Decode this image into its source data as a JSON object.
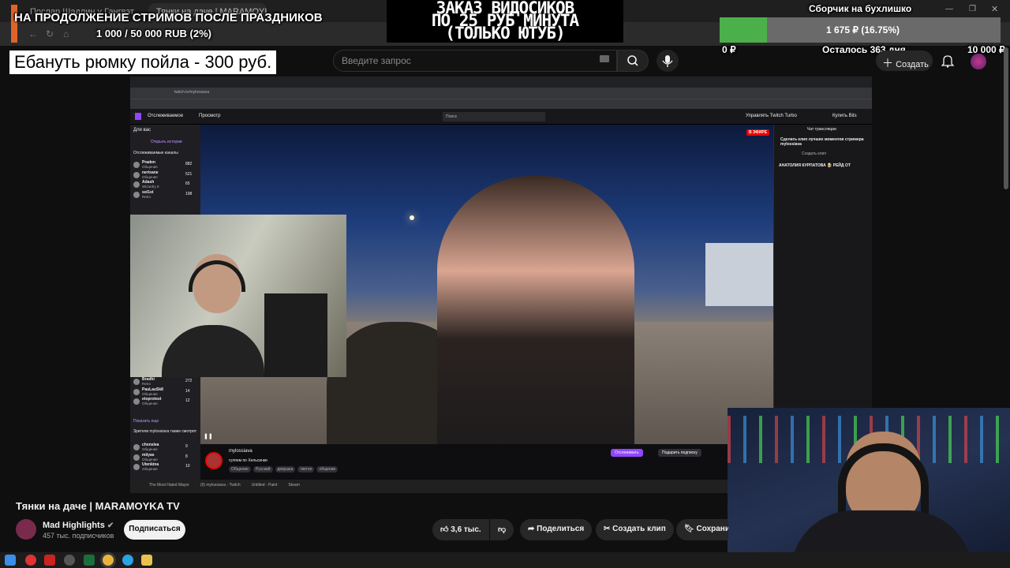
{
  "browser": {
    "tabs": [
      {
        "label": "Послар Шадлин у Гангвэт"
      },
      {
        "label": "Тянки на даче | MARAMOYKA"
      }
    ]
  },
  "overlay": {
    "stream_goal": "НА ПРОДОЛЖЕНИЕ СТРИМОВ ПОСЛЕ ПРАЗДНИКОВ",
    "stream_goal_progress": "1 000 / 50 000 RUB (2%)",
    "video_order": [
      "ЗАКАЗ ВИДОСИКОВ",
      "ПО 25 РУБ МИНУТА",
      "(ТОЛЬКО ЮТУБ)"
    ],
    "shot_price": "Ебануть рюмку пойла - 300 руб.",
    "fund_title": "Сборчик на бухлишко",
    "fund_progress_text": "1 675 ₽ (16.75%)",
    "fund_progress_fraction": 0.1675,
    "fund_min": "0 ₽",
    "fund_remaining": "Осталось 363 дня",
    "fund_max": "10 000 ₽",
    "accent_goal": "#e0642a",
    "accent_fund": "#4cb04a"
  },
  "youtube": {
    "search_placeholder": "Введите запрос",
    "create_label": "Создать",
    "video_title": "Тянки на даче | MARAMOYKA TV",
    "channel_name": "Mad Highlights",
    "subscribers": "457 тыс. подписчиков",
    "subscribe_label": "Подписаться",
    "likes": "3,6 тыс.",
    "share_label": "Поделиться",
    "clip_label": "Создать клип",
    "save_label": "Сохрани"
  },
  "twitch": {
    "nav_following": "Отслеживаемое",
    "nav_browse": "Просмотр",
    "search_placeholder": "Поиск",
    "turbo_label": "Управлять Twitch Turbo",
    "bits_label": "Купить Bits",
    "for_you": "Для вас",
    "open_history": "Открыть истории",
    "followed_channels": "Отслеживаемые каналы",
    "channels_top": [
      {
        "name": "Praden",
        "game": "Общение",
        "viewers": "882"
      },
      {
        "name": "nerixane",
        "game": "Общение",
        "viewers": "521"
      },
      {
        "name": "Adash",
        "game": "Wizardry 8",
        "viewers": "65"
      },
      {
        "name": "sol1st",
        "game": "Retro",
        "viewers": "198"
      }
    ],
    "channels_bottom": [
      {
        "name": "Bradhi",
        "game": "Retro",
        "viewers": "272"
      },
      {
        "name": "PauLauSk8",
        "game": "Общение",
        "viewers": "14"
      },
      {
        "name": "etoprotest",
        "game": "Общение",
        "viewers": "12"
      }
    ],
    "show_more": "Показать еще",
    "also_watch": "Зрители mylossiava также смотрят",
    "channels_also": [
      {
        "name": "chenslea",
        "game": "Общение",
        "viewers": "9"
      },
      {
        "name": "miiyas",
        "game": "Общение",
        "viewers": "8"
      },
      {
        "name": "Utenkina",
        "game": "Общение",
        "viewers": "10"
      }
    ],
    "live_badge": "В ЭФИРЕ",
    "streamer": "mylossiava",
    "stream_title": "гуляем по Хельсинки",
    "tags": [
      "Общение",
      "Русский",
      "девушка",
      "тиктон",
      "общение"
    ],
    "follow_label": "Отслеживать",
    "gift_sub_label": "Подарить подписку",
    "chat_title": "Чат трансляции",
    "chat_clip_promo": "Сделать клип лучших моментов стримера mylossiava",
    "chat_clip_btn": "Создать клип",
    "chat_raid": "АНАТОЛИЯ КУРПАТОВА 🍺 РЕЙД ОТ",
    "url": "twitch.tv/mylossiava"
  },
  "taskbar": {
    "items": [
      "The Most Hated Mayor",
      "(9) mylossiava - Twitch",
      "Untitled - Paint",
      "Steam"
    ]
  }
}
